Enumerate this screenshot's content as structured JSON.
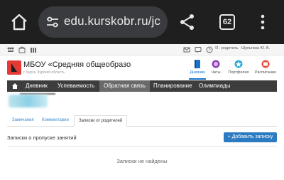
{
  "browser": {
    "url": "edu.kurskobr.ru/jc",
    "tab_count": "62"
  },
  "util_bar": {
    "role": "Я - родитель",
    "user_name": "Шульгина Ю. В."
  },
  "school": {
    "name": "МБОУ «Средняя общеобразовате",
    "address": "г. Курск, Курская область"
  },
  "top_nav": [
    {
      "label": "Дневник",
      "icon": "diary-icon"
    },
    {
      "label": "Чаты",
      "icon": "chat-icon"
    },
    {
      "label": "Портфолио",
      "icon": "portfolio-icon"
    },
    {
      "label": "Расписание",
      "icon": "schedule-icon"
    }
  ],
  "menu": {
    "items": [
      "Дневник",
      "Успеваемость",
      "Обратная связь",
      "Планирование",
      "Олимпиады"
    ],
    "selected": "Обратная связь"
  },
  "subtabs": {
    "items": [
      "Замечания",
      "Комментарии",
      "Записки от родителей"
    ],
    "selected": "Записки от родителей"
  },
  "section": {
    "title": "Записки о пропуске занятий",
    "add_button": "+ Добавить записку",
    "empty_text": "Записки не найдены"
  },
  "colors": {
    "accent": "#2b7bc3",
    "menu_bg": "#3d3d3d",
    "brand_red": "#e53935"
  }
}
